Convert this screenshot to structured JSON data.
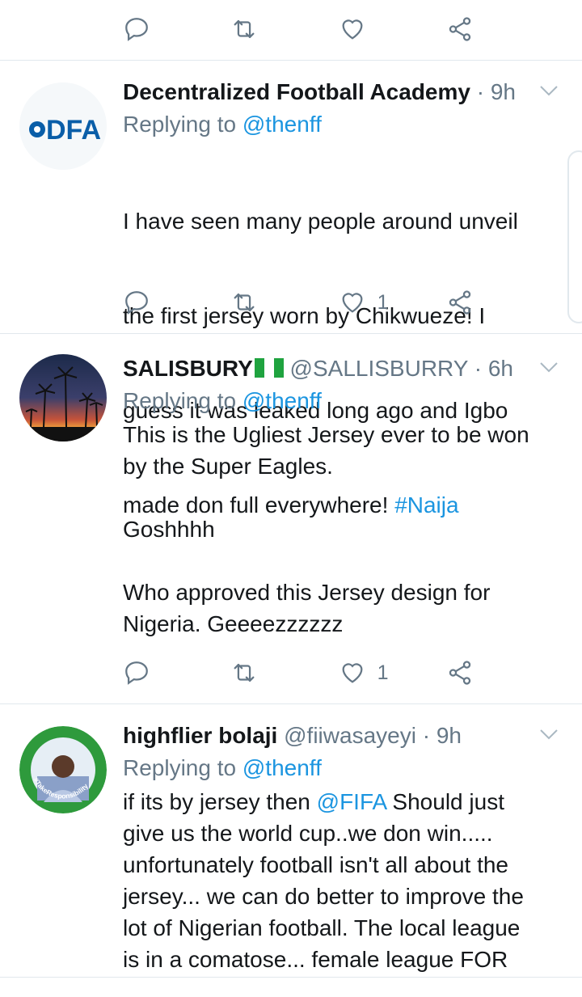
{
  "tweets": [
    {
      "name": "Decentralized Football Academy",
      "handle": "",
      "separator": "·",
      "time": "9h",
      "replying_prefix": "Replying to",
      "replying_to": "@thenff",
      "text_lines": [
        "I have seen many people around unveil",
        "the first jersey worn by Chikwueze! I",
        "guess it was leaked long ago and Igbo",
        "made don full everywhere!"
      ],
      "hashtag": "#Naija",
      "likes": "1",
      "avatar_text": "DFA"
    },
    {
      "name": "SALISBURY",
      "handle": "@SALLISBURRY",
      "separator": "·",
      "time": "6h",
      "replying_prefix": "Replying to",
      "replying_to": "@thenff",
      "text": "This is the Ugliest Jersey ever to be won\nby the Super Eagles.\n\nGoshhhh\n\nWho approved this Jersey design for\nNigeria. Geeeezzzzzz",
      "likes": "1"
    },
    {
      "name": "highflier bolaji",
      "handle": "@fiiwasayeyi",
      "separator": "·",
      "time": "9h",
      "replying_prefix": "Replying to",
      "replying_to": "@thenff",
      "text_prefix": "if its by jersey then ",
      "mention": "@FIFA",
      "text_rest": " Should just\ngive us the world cup..we don win.....\nunfortunately football isn't all about the\njersey... we can do better to improve the\nlot of Nigerian football. The local league\nis in a comatose... female league FOR",
      "avatar_text": "#TakeResponsibility"
    }
  ],
  "colors": {
    "link": "#1b95e0",
    "muted": "#657786",
    "divider": "#e1e8ed"
  }
}
